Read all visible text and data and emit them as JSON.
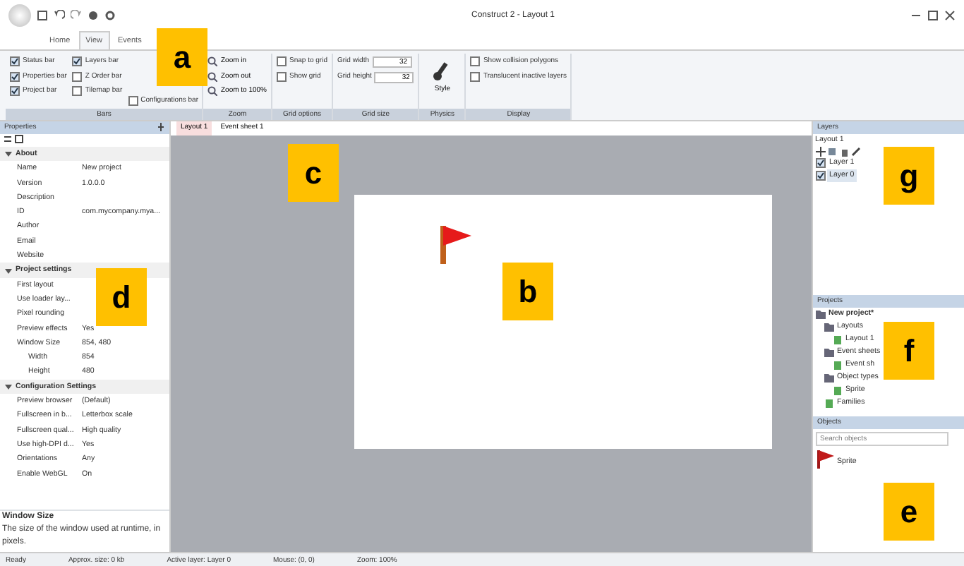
{
  "window": {
    "title": "Construct 2 - Layout 1"
  },
  "ribbon_tabs": [
    {
      "label": "Home",
      "selected": false
    },
    {
      "label": "View",
      "selected": true
    },
    {
      "label": "Events",
      "selected": false
    }
  ],
  "ribbon_groups": [
    {
      "label": "Bars",
      "columns": [
        [
          {
            "kind": "checkbox",
            "label": "Status bar",
            "checked": true
          },
          {
            "kind": "checkbox",
            "label": "Properties bar",
            "checked": true
          },
          {
            "kind": "checkbox",
            "label": "Project bar",
            "checked": true
          }
        ],
        [
          {
            "kind": "checkbox",
            "label": "Layers bar",
            "checked": true
          },
          {
            "kind": "checkbox",
            "label": "Z Order bar",
            "checked": false
          },
          {
            "kind": "checkbox",
            "label": "Tilemap bar",
            "checked": false
          }
        ],
        [
          {
            "kind": "checkbox",
            "label": "Configurations bar",
            "checked": false
          }
        ]
      ]
    },
    {
      "label": "Zoom",
      "columns": [
        [
          {
            "kind": "command",
            "label": "Zoom in"
          },
          {
            "kind": "command",
            "label": "Zoom out"
          },
          {
            "kind": "command",
            "label": "Zoom to 100%"
          }
        ]
      ]
    },
    {
      "label": "Grid options",
      "columns": [
        [
          {
            "kind": "checkbox",
            "label": "Snap to grid",
            "checked": false
          },
          {
            "kind": "checkbox",
            "label": "Show grid",
            "checked": false
          }
        ]
      ]
    },
    {
      "label": "Grid size",
      "columns": [
        [
          {
            "kind": "number",
            "label": "Grid width",
            "value": "32"
          },
          {
            "kind": "number",
            "label": "Grid height",
            "value": "32"
          }
        ]
      ]
    },
    {
      "label": "Physics",
      "columns": [
        [
          {
            "kind": "large",
            "label": "Style"
          }
        ]
      ]
    },
    {
      "label": "Display",
      "columns": [
        [
          {
            "kind": "checkbox",
            "label": "Show collision polygons",
            "checked": false
          },
          {
            "kind": "checkbox",
            "label": "Translucent inactive layers",
            "checked": false
          }
        ]
      ]
    }
  ],
  "properties": {
    "title": "Properties",
    "groups": [
      {
        "label": "About",
        "expanded": true,
        "rows": [
          {
            "name": "Name",
            "value": "New project"
          },
          {
            "name": "Version",
            "value": "1.0.0.0"
          },
          {
            "name": "Description",
            "value": ""
          },
          {
            "name": "ID",
            "value": "com.mycompany.mya..."
          },
          {
            "name": "Author",
            "value": ""
          },
          {
            "name": "Email",
            "value": ""
          },
          {
            "name": "Website",
            "value": ""
          }
        ]
      },
      {
        "label": "Project settings",
        "expanded": true,
        "rows": [
          {
            "name": "First layout",
            "value": ""
          },
          {
            "name": "Use loader lay...",
            "value": ""
          },
          {
            "name": "Pixel rounding",
            "value": ""
          },
          {
            "name": "Preview effects",
            "value": "Yes"
          },
          {
            "name": "Window Size",
            "value": "854, 480",
            "children": [
              {
                "name": "Width",
                "value": "854"
              },
              {
                "name": "Height",
                "value": "480"
              }
            ]
          }
        ]
      },
      {
        "label": "Configuration Settings",
        "expanded": true,
        "rows": [
          {
            "name": "Preview browser",
            "value": "(Default)"
          },
          {
            "name": "Fullscreen in b...",
            "value": "Letterbox scale"
          },
          {
            "name": "Fullscreen qual...",
            "value": "High quality"
          },
          {
            "name": "Use high-DPI d...",
            "value": "Yes"
          },
          {
            "name": "Orientations",
            "value": "Any"
          },
          {
            "name": "Enable WebGL",
            "value": "On"
          }
        ]
      }
    ],
    "help_title": "Window Size",
    "help_text": "The size of the window used at runtime, in pixels."
  },
  "doc_tabs": [
    {
      "label": "Layout 1",
      "selected": true
    },
    {
      "label": "Event sheet 1",
      "selected": false
    }
  ],
  "layers": {
    "title": "Layers",
    "subtitle": "Layout 1",
    "items": [
      {
        "label": "Layer 1",
        "visible": true,
        "selected": false
      },
      {
        "label": "Layer 0",
        "visible": true,
        "selected": true
      }
    ]
  },
  "projects": {
    "title": "Projects",
    "tree": [
      {
        "label": "New project*",
        "children": [
          {
            "label": "Layouts",
            "children": [
              {
                "label": "Layout 1"
              }
            ]
          },
          {
            "label": "Event sheets",
            "children": [
              {
                "label": "Event sh"
              }
            ]
          },
          {
            "label": "Object types",
            "children": [
              {
                "label": "Sprite"
              }
            ]
          },
          {
            "label": "Families"
          }
        ]
      }
    ]
  },
  "objects": {
    "title": "Objects",
    "placeholder": "Search objects",
    "items": [
      {
        "label": "Sprite"
      }
    ]
  },
  "status_bar": [
    "Ready",
    "Approx. size: 0 kb",
    "Active layer: Layer 0",
    "Mouse: (0, 0)",
    "Zoom: 100%"
  ],
  "annotations": [
    "a",
    "c",
    "g",
    "b",
    "d",
    "f",
    "e"
  ]
}
